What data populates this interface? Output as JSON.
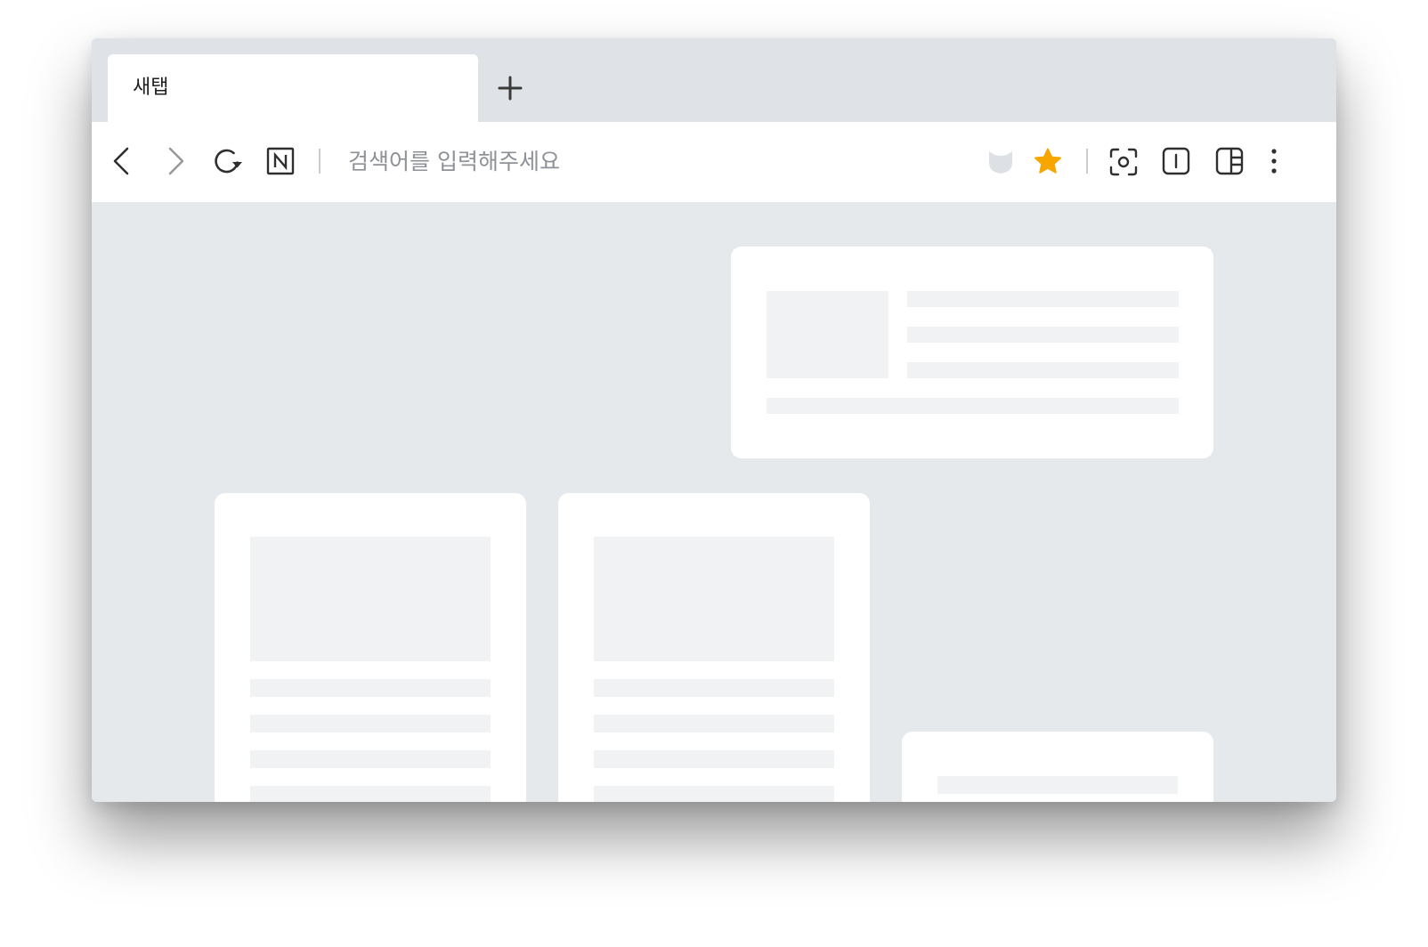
{
  "tabs": [
    {
      "label": "새탭",
      "active": true
    }
  ],
  "new_tab_icon": "plus-icon",
  "toolbar": {
    "back_icon": "chevron-left-icon",
    "forward_icon": "chevron-right-icon",
    "reload_icon": "reload-icon",
    "home_icon": "naver-n-icon",
    "address_placeholder": "검색어를 입력해주세요",
    "address_value": "",
    "shield_icon": "shield-icon",
    "bookmark_icon": "star-icon",
    "screenshot_icon": "capture-icon",
    "text_cursor_icon": "text-cursor-icon",
    "sidebar_icon": "sidebar-icon",
    "menu_icon": "more-vertical-icon"
  },
  "colors": {
    "tabbar_bg": "#dfe2e6",
    "content_bg": "#e6e9ec",
    "card_bg": "#ffffff",
    "placeholder_block": "#f1f2f4",
    "star": "#f7a600",
    "shield": "#dde1e5"
  }
}
